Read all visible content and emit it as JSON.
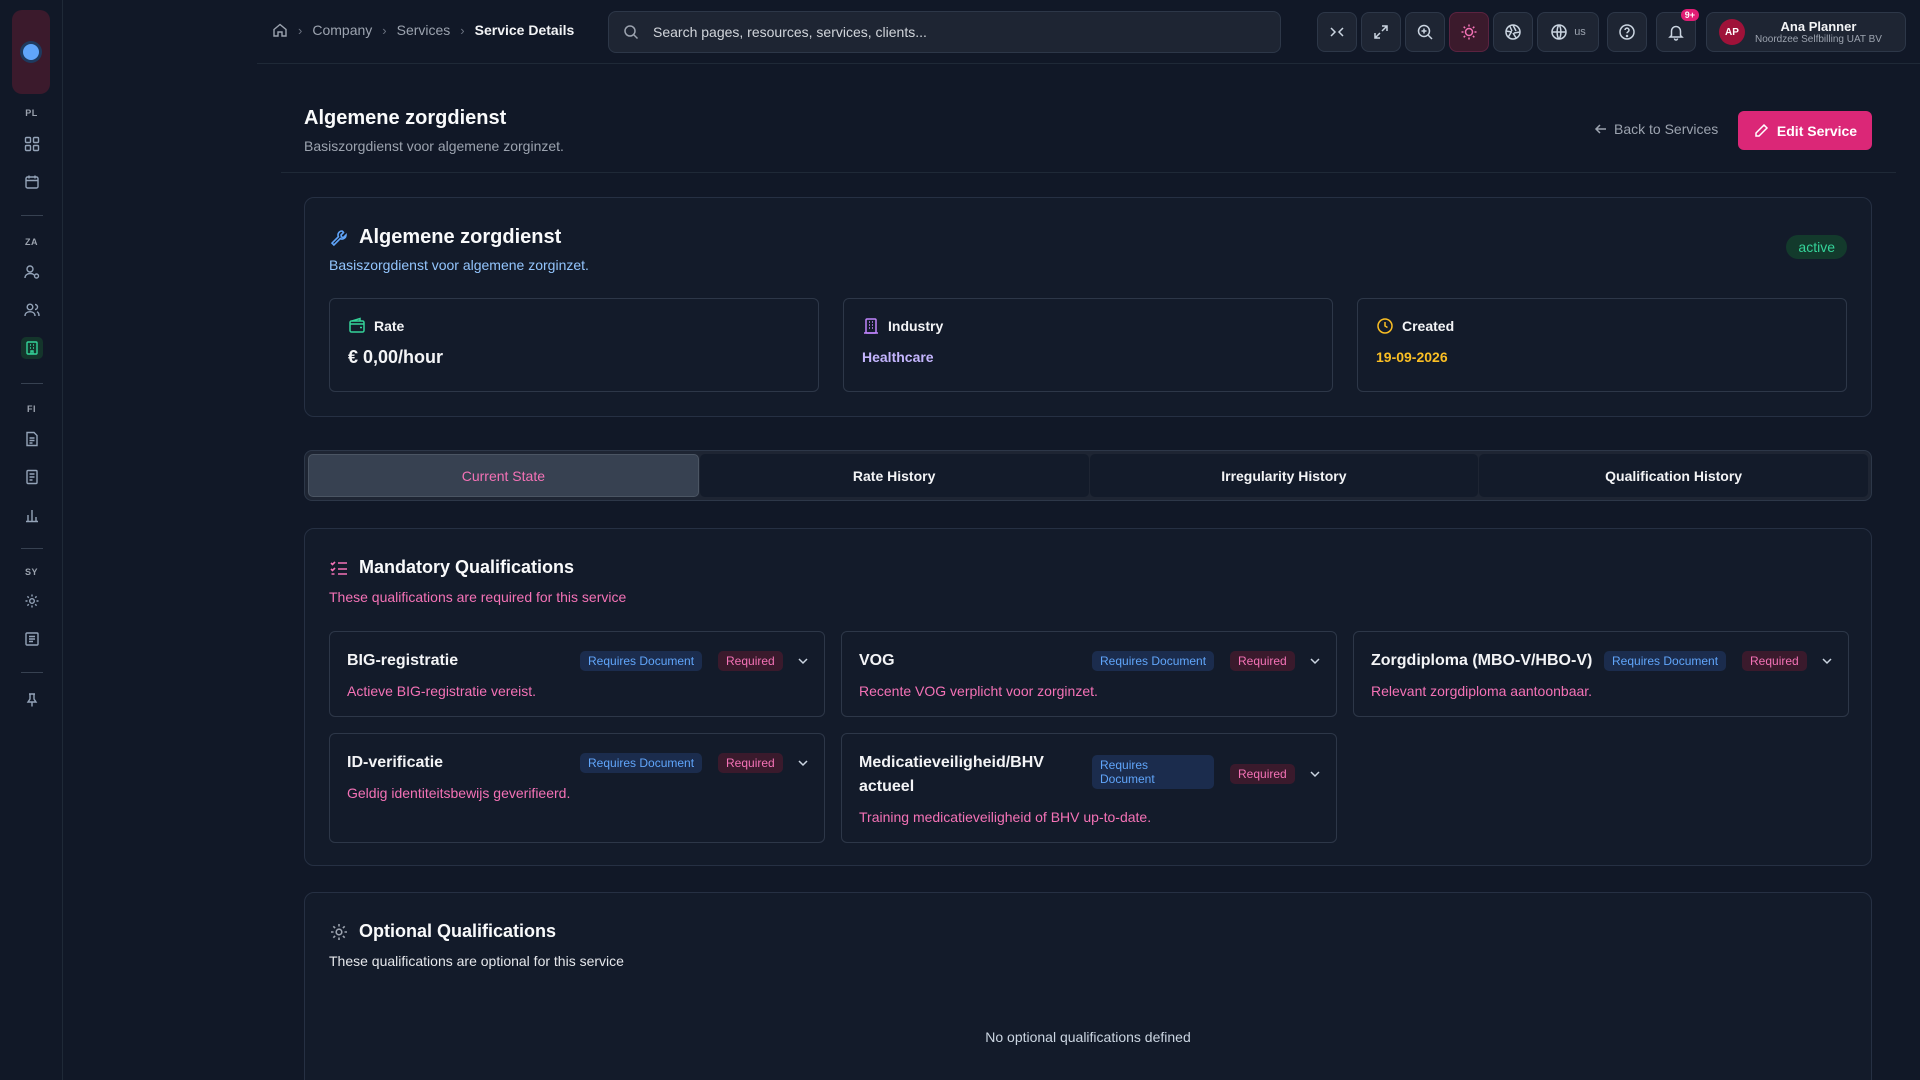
{
  "breadcrumb": {
    "items": [
      "Company",
      "Services"
    ],
    "current": "Service Details"
  },
  "search": {
    "placeholder": "Search pages, resources, services, clients..."
  },
  "topbar": {
    "language": "us",
    "notifications_count": "9+"
  },
  "user": {
    "initials": "AP",
    "name": "Ana Planner",
    "org": "Noordzee Selfbilling UAT BV"
  },
  "sidebar": {
    "sections": [
      "PL",
      "ZA",
      "FI",
      "SY"
    ]
  },
  "page": {
    "title": "Algemene zorgdienst",
    "subtitle": "Basiszorgdienst voor algemene zorginzet.",
    "back_label": "Back to Services",
    "edit_label": "Edit Service"
  },
  "service": {
    "name": "Algemene zorgdienst",
    "description": "Basiszorgdienst voor algemene zorginzet.",
    "status": "active",
    "rate_label": "Rate",
    "rate_value": "€ 0,00/hour",
    "industry_label": "Industry",
    "industry_value": "Healthcare",
    "created_label": "Created",
    "created_value": "19-09-2026"
  },
  "tabs": [
    "Current State",
    "Rate History",
    "Irregularity History",
    "Qualification History"
  ],
  "mandatory": {
    "title": "Mandatory Qualifications",
    "subtitle": "These qualifications are required for this service",
    "doc_label": "Requires Document",
    "req_label": "Required",
    "items": [
      {
        "name": "BIG-registratie",
        "description": "Actieve BIG-registratie vereist."
      },
      {
        "name": "VOG",
        "description": "Recente VOG verplicht voor zorginzet."
      },
      {
        "name": "Zorgdiploma (MBO-V/HBO-V)",
        "description": "Relevant zorgdiploma aantoonbaar."
      },
      {
        "name": "ID-verificatie",
        "description": "Geldig identiteitsbewijs geverifieerd."
      },
      {
        "name": "Medicatieveiligheid/BHV actueel",
        "description": "Training medicatieveiligheid of BHV up-to-date."
      }
    ]
  },
  "optional": {
    "title": "Optional Qualifications",
    "subtitle": "These qualifications are optional for this service",
    "empty": "No optional qualifications defined"
  },
  "colors": {
    "accent": "#db2777",
    "success": "#34d399",
    "info": "#60a5fa",
    "industry": "#c4b5fd",
    "created": "#fbbf24"
  }
}
